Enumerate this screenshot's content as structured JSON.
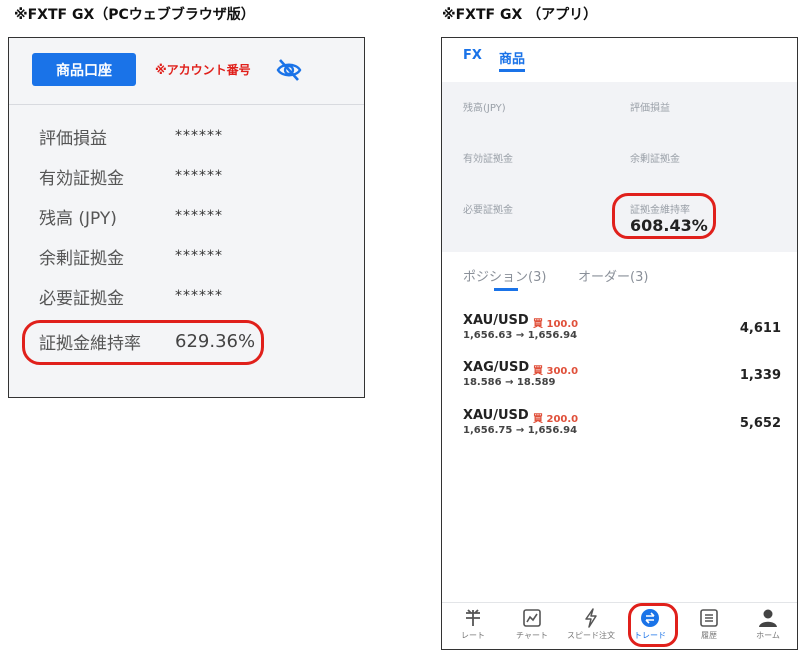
{
  "captions": {
    "left": "※FXTF GX（PCウェブブラウザ版）",
    "right": "※FXTF GX （アプリ）"
  },
  "pc": {
    "account_tab": "商品口座",
    "account_number": "※アカウント番号",
    "rows": [
      {
        "label": "評価損益",
        "value": "******"
      },
      {
        "label": "有効証拠金",
        "value": "******"
      },
      {
        "label": "残高 (JPY)",
        "value": "******"
      },
      {
        "label": "余剰証拠金",
        "value": "******"
      },
      {
        "label": "必要証拠金",
        "value": "******"
      },
      {
        "label": "証拠金維持率",
        "value": "629.36%"
      }
    ]
  },
  "app": {
    "tabs": [
      "FX",
      "商品"
    ],
    "summary": {
      "balance": "残高(JPY)",
      "unrealized_pl": "評価損益",
      "equity": "有効証拠金",
      "free_margin": "余剰証拠金",
      "required_margin": "必要証拠金",
      "margin_ratio_label": "証拠金維持率",
      "margin_ratio_value": "608.43%"
    },
    "list_tabs": [
      "ポジション(3)",
      "オーダー(3)"
    ],
    "positions": [
      {
        "symbol": "XAU/USD",
        "side": "買 100.0",
        "prices": "1,656.63 → 1,656.94",
        "pl": "4,611"
      },
      {
        "symbol": "XAG/USD",
        "side": "買 300.0",
        "prices": "18.586 → 18.589",
        "pl": "1,339"
      },
      {
        "symbol": "XAU/USD",
        "side": "買 200.0",
        "prices": "1,656.75 → 1,656.94",
        "pl": "5,652"
      }
    ],
    "nav": [
      {
        "label": "レート",
        "icon": "rate-icon"
      },
      {
        "label": "チャート",
        "icon": "chart-icon"
      },
      {
        "label": "スピード注文",
        "icon": "lightning-icon"
      },
      {
        "label": "トレード",
        "icon": "trade-icon"
      },
      {
        "label": "履歴",
        "icon": "history-icon"
      },
      {
        "label": "ホーム",
        "icon": "user-icon"
      }
    ],
    "accent": "#1a73e8",
    "highlight": "#e0201b"
  }
}
